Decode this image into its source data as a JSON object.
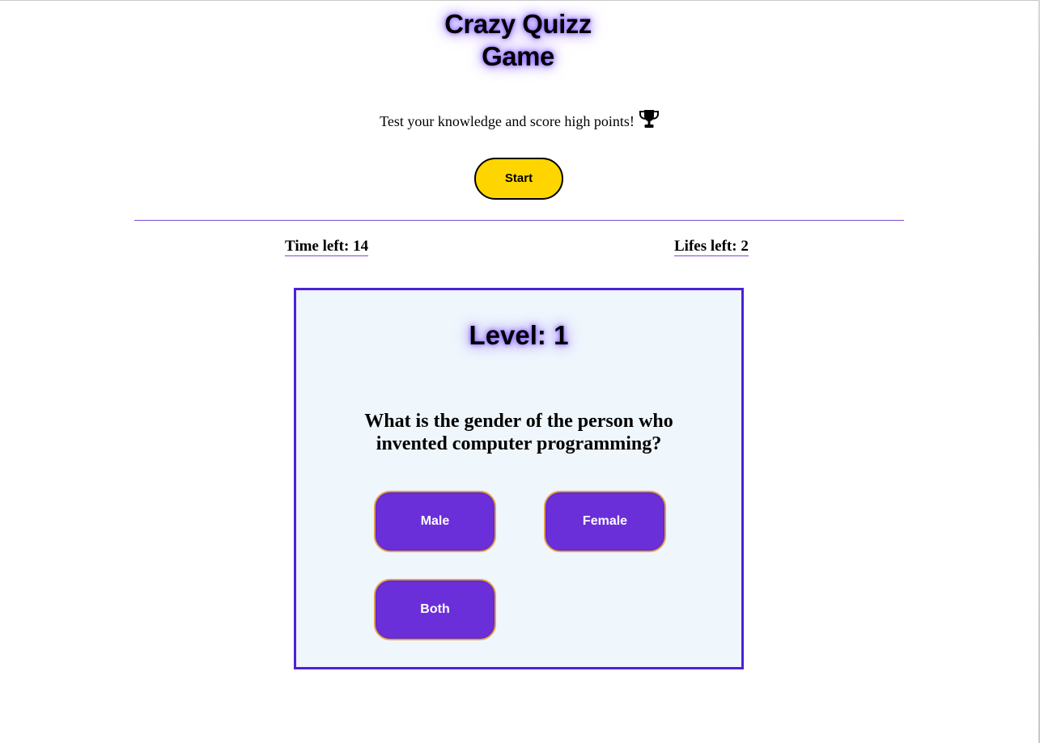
{
  "header": {
    "title_line1": "Crazy Quizz",
    "title_line2": "Game",
    "subtitle": "Test your knowledge and score high points!",
    "subtitle_icon": "trophy-icon",
    "start_label": "Start",
    "start_color": "#ffd500"
  },
  "stats": {
    "time_label": "Time left:",
    "time_value": "14",
    "lifes_label": "Lifes left:",
    "lifes_value": "2"
  },
  "quiz": {
    "level_label": "Level:",
    "level_value": "1",
    "question": "What is the gender of the person who invented computer programming?",
    "answers": [
      {
        "label": "Male"
      },
      {
        "label": "Female"
      },
      {
        "label": "Both"
      }
    ]
  },
  "colors": {
    "accent": "#6a2fd9",
    "card_border": "#4b22d8",
    "card_bg": "#eff6fc",
    "divider": "#7a4bd6",
    "answer_border": "#e0a24a"
  }
}
